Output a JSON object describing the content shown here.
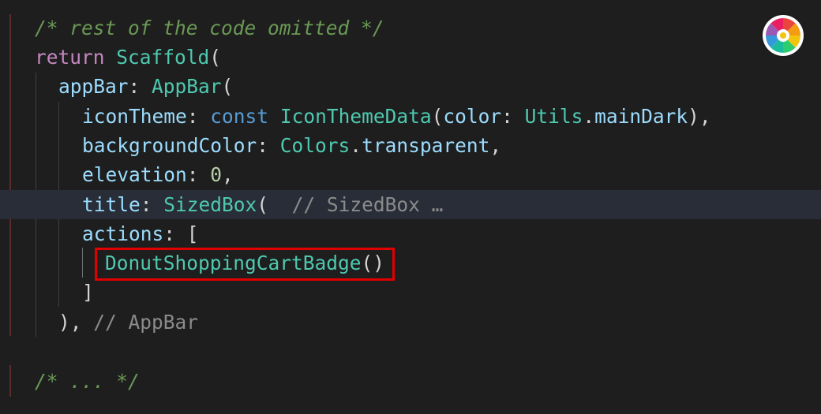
{
  "editor": {
    "lines": [
      {
        "tokens": [
          {
            "t": "/* rest of the code omitted */",
            "c": "c-comment"
          }
        ]
      },
      {
        "tokens": [
          {
            "t": "return",
            "c": "c-keyword"
          },
          {
            "t": " ",
            "c": "c-punc"
          },
          {
            "t": "Scaffold",
            "c": "c-class"
          },
          {
            "t": "(",
            "c": "c-punc"
          }
        ]
      },
      {
        "tokens": [
          {
            "t": "appBar",
            "c": "c-prop"
          },
          {
            "t": ": ",
            "c": "c-punc"
          },
          {
            "t": "AppBar",
            "c": "c-class"
          },
          {
            "t": "(",
            "c": "c-punc"
          }
        ]
      },
      {
        "tokens": [
          {
            "t": "iconTheme",
            "c": "c-prop"
          },
          {
            "t": ": ",
            "c": "c-punc"
          },
          {
            "t": "const",
            "c": "c-storage"
          },
          {
            "t": " ",
            "c": "c-punc"
          },
          {
            "t": "IconThemeData",
            "c": "c-class"
          },
          {
            "t": "(",
            "c": "c-punc"
          },
          {
            "t": "color",
            "c": "c-prop"
          },
          {
            "t": ": ",
            "c": "c-punc"
          },
          {
            "t": "Utils",
            "c": "c-class"
          },
          {
            "t": ".",
            "c": "c-punc"
          },
          {
            "t": "mainDark",
            "c": "c-prop"
          },
          {
            "t": "),",
            "c": "c-punc"
          }
        ]
      },
      {
        "tokens": [
          {
            "t": "backgroundColor",
            "c": "c-prop"
          },
          {
            "t": ": ",
            "c": "c-punc"
          },
          {
            "t": "Colors",
            "c": "c-class"
          },
          {
            "t": ".",
            "c": "c-punc"
          },
          {
            "t": "transparent",
            "c": "c-prop"
          },
          {
            "t": ",",
            "c": "c-punc"
          }
        ]
      },
      {
        "tokens": [
          {
            "t": "elevation",
            "c": "c-prop"
          },
          {
            "t": ": ",
            "c": "c-punc"
          },
          {
            "t": "0",
            "c": "c-num"
          },
          {
            "t": ",",
            "c": "c-punc"
          }
        ]
      },
      {
        "tokens": [
          {
            "t": "title",
            "c": "c-prop"
          },
          {
            "t": ": ",
            "c": "c-punc"
          },
          {
            "t": "SizedBox",
            "c": "c-class"
          },
          {
            "t": "(",
            "c": "c-punc"
          },
          {
            "t": "  // SizedBox …",
            "c": "c-hint"
          }
        ]
      },
      {
        "tokens": [
          {
            "t": "actions",
            "c": "c-prop"
          },
          {
            "t": ": [",
            "c": "c-punc"
          }
        ]
      },
      {
        "tokens": [
          {
            "t": "DonutShoppingCartBadge",
            "c": "c-class"
          },
          {
            "t": "()",
            "c": "c-punc"
          }
        ]
      },
      {
        "tokens": [
          {
            "t": "]",
            "c": "c-punc"
          }
        ]
      },
      {
        "tokens": [
          {
            "t": "),",
            "c": "c-punc"
          },
          {
            "t": " // AppBar",
            "c": "c-hint"
          }
        ]
      },
      {
        "tokens": []
      },
      {
        "tokens": [
          {
            "t": "/* ... */",
            "c": "c-comment"
          }
        ]
      }
    ]
  },
  "logo": {
    "icon": "color-wheel-icon",
    "colors": [
      "#e8453c",
      "#f39c12",
      "#f1c40f",
      "#2ecc71",
      "#1abc9c",
      "#3498db",
      "#9b59b6",
      "#e91e63"
    ]
  },
  "highlight": {
    "color": "#e00000"
  }
}
